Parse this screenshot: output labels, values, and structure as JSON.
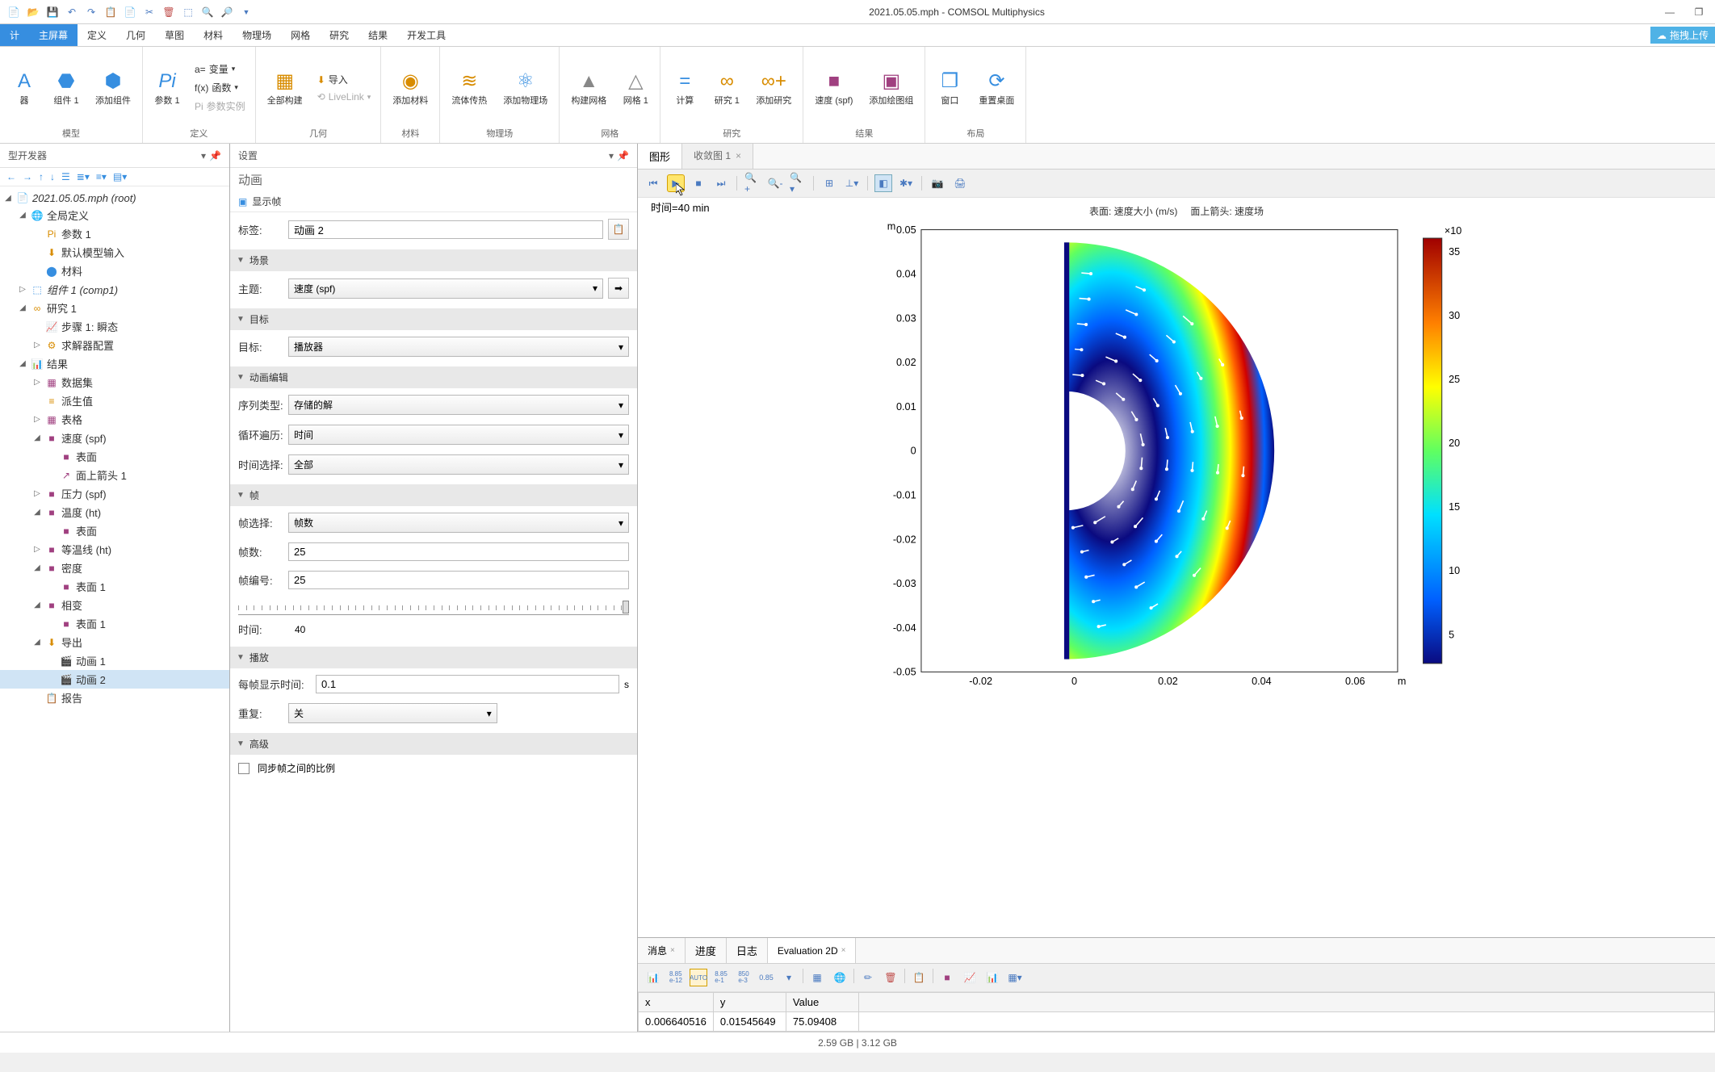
{
  "app_title": "2021.05.05.mph - COMSOL Multiphysics",
  "cloud_btn": "拖拽上传",
  "menu_tabs": [
    "计",
    "主屏幕",
    "定义",
    "几何",
    "草图",
    "材料",
    "物理场",
    "网格",
    "研究",
    "结果",
    "开发工具"
  ],
  "ribbon": {
    "model": {
      "label": "模型",
      "items": [
        "器",
        "组件 1",
        "添加组件"
      ]
    },
    "definition": {
      "label": "定义",
      "main": "参数 1",
      "sub": [
        "变量",
        "函数",
        "参数实例"
      ]
    },
    "geometry": {
      "label": "几何",
      "main": "全部构建",
      "sub": [
        "导入",
        "LiveLink"
      ]
    },
    "material": {
      "label": "材料",
      "main": "添加材料"
    },
    "physics": {
      "label": "物理场",
      "items": [
        "流体传热",
        "添加物理场"
      ]
    },
    "mesh": {
      "label": "网格",
      "items": [
        "构建网格",
        "网格 1"
      ]
    },
    "study": {
      "label": "研究",
      "items": [
        "计算",
        "研究 1",
        "添加研究"
      ]
    },
    "results": {
      "label": "结果",
      "items": [
        "速度 (spf)",
        "添加绘图组"
      ]
    },
    "layout": {
      "label": "布局",
      "items": [
        "窗口",
        "重置桌面"
      ]
    }
  },
  "tree_panel_title": "型开发器",
  "tree": [
    {
      "indent": 0,
      "exp": "◢",
      "icon": "📄",
      "label": "2021.05.05.mph (root)",
      "italic": true
    },
    {
      "indent": 1,
      "exp": "◢",
      "icon": "🌐",
      "label": "全局定义",
      "color": "#d88c00"
    },
    {
      "indent": 2,
      "exp": "",
      "icon": "Pi",
      "label": "参数 1",
      "iconcolor": "#d88c00"
    },
    {
      "indent": 2,
      "exp": "",
      "icon": "⬇",
      "label": "默认模型输入",
      "iconcolor": "#d88c00"
    },
    {
      "indent": 2,
      "exp": "",
      "icon": "⬤",
      "label": "材料",
      "iconcolor": "#368ee0"
    },
    {
      "indent": 1,
      "exp": "▷",
      "icon": "⬚",
      "label": "组件 1 (comp1)",
      "italic": true,
      "iconcolor": "#368ee0"
    },
    {
      "indent": 1,
      "exp": "◢",
      "icon": "∞",
      "label": "研究 1",
      "iconcolor": "#d88c00"
    },
    {
      "indent": 2,
      "exp": "",
      "icon": "📈",
      "label": "步骤 1: 瞬态",
      "iconcolor": "#368ee0"
    },
    {
      "indent": 2,
      "exp": "▷",
      "icon": "⚙",
      "label": "求解器配置",
      "iconcolor": "#d88c00"
    },
    {
      "indent": 1,
      "exp": "◢",
      "icon": "📊",
      "label": "结果",
      "iconcolor": "#a04080"
    },
    {
      "indent": 2,
      "exp": "▷",
      "icon": "▦",
      "label": "数据集",
      "iconcolor": "#a04080"
    },
    {
      "indent": 2,
      "exp": "",
      "icon": "≡",
      "label": "派生值",
      "iconcolor": "#d88c00"
    },
    {
      "indent": 2,
      "exp": "▷",
      "icon": "▦",
      "label": "表格",
      "iconcolor": "#a04080"
    },
    {
      "indent": 2,
      "exp": "◢",
      "icon": "■",
      "label": "速度 (spf)",
      "iconcolor": "#a04080"
    },
    {
      "indent": 3,
      "exp": "",
      "icon": "■",
      "label": "表面",
      "iconcolor": "#a04080"
    },
    {
      "indent": 3,
      "exp": "",
      "icon": "↗",
      "label": "面上箭头 1",
      "iconcolor": "#a04080"
    },
    {
      "indent": 2,
      "exp": "▷",
      "icon": "■",
      "label": "压力 (spf)",
      "iconcolor": "#a04080"
    },
    {
      "indent": 2,
      "exp": "◢",
      "icon": "■",
      "label": "温度 (ht)",
      "iconcolor": "#a04080"
    },
    {
      "indent": 3,
      "exp": "",
      "icon": "■",
      "label": "表面",
      "iconcolor": "#a04080"
    },
    {
      "indent": 2,
      "exp": "▷",
      "icon": "■",
      "label": "等温线 (ht)",
      "iconcolor": "#a04080"
    },
    {
      "indent": 2,
      "exp": "◢",
      "icon": "■",
      "label": "密度",
      "iconcolor": "#a04080"
    },
    {
      "indent": 3,
      "exp": "",
      "icon": "■",
      "label": "表面 1",
      "iconcolor": "#a04080"
    },
    {
      "indent": 2,
      "exp": "◢",
      "icon": "■",
      "label": "相变",
      "iconcolor": "#a04080"
    },
    {
      "indent": 3,
      "exp": "",
      "icon": "■",
      "label": "表面 1",
      "iconcolor": "#a04080"
    },
    {
      "indent": 2,
      "exp": "◢",
      "icon": "⬇",
      "label": "导出",
      "iconcolor": "#d88c00"
    },
    {
      "indent": 3,
      "exp": "",
      "icon": "🎬",
      "label": "动画 1",
      "iconcolor": "#a04080"
    },
    {
      "indent": 3,
      "exp": "",
      "icon": "🎬",
      "label": "动画 2",
      "selected": true,
      "iconcolor": "#a04080"
    },
    {
      "indent": 2,
      "exp": "",
      "icon": "📋",
      "label": "报告",
      "iconcolor": "#a04080"
    }
  ],
  "settings": {
    "title": "设置",
    "subtitle": "动画",
    "show_frame": "显示帧",
    "label_field": {
      "label": "标签:",
      "value": "动画 2"
    },
    "section_scene": "场景",
    "subject": {
      "label": "主题:",
      "value": "速度 (spf)"
    },
    "section_target": "目标",
    "target": {
      "label": "目标:",
      "value": "播放器"
    },
    "section_edit": "动画编辑",
    "seq_type": {
      "label": "序列类型:",
      "value": "存储的解"
    },
    "loop": {
      "label": "循环遍历:",
      "value": "时间"
    },
    "time_sel": {
      "label": "时间选择:",
      "value": "全部"
    },
    "section_frame": "帧",
    "frame_sel": {
      "label": "帧选择:",
      "value": "帧数"
    },
    "frames": {
      "label": "帧数:",
      "value": "25"
    },
    "frame_no": {
      "label": "帧编号:",
      "value": "25"
    },
    "time": {
      "label": "时间:",
      "value": "40"
    },
    "section_play": "播放",
    "per_frame": {
      "label": "每帧显示时间:",
      "value": "0.1",
      "unit": "s"
    },
    "repeat": {
      "label": "重复:",
      "value": "关"
    },
    "section_adv": "高级",
    "sync_scale": "同步帧之间的比例"
  },
  "graphics": {
    "tab1": "图形",
    "tab2": "收敛图 1",
    "time_label": "时间=40 min",
    "surf_title": "表面: 速度大小 (m/s)",
    "arrow_title": "面上箭头: 速度场",
    "y_unit": "m",
    "x_unit": "m",
    "cb_unit": "×10",
    "y_ticks": [
      "0.05",
      "0.04",
      "0.03",
      "0.02",
      "0.01",
      "0",
      "-0.01",
      "-0.02",
      "-0.03",
      "-0.04",
      "-0.05"
    ],
    "x_ticks": [
      "-0.02",
      "0",
      "0.02",
      "0.04",
      "0.06"
    ],
    "cb_ticks": [
      "35",
      "30",
      "25",
      "20",
      "15",
      "10",
      "5"
    ]
  },
  "bottom_tabs": [
    "消息",
    "进度",
    "日志",
    "Evaluation 2D"
  ],
  "eval_table": {
    "headers": [
      "x",
      "y",
      "Value"
    ],
    "row": [
      "0.006640516",
      "0.01545649",
      "75.09408"
    ]
  },
  "status": "2.59 GB | 3.12 GB",
  "chart_data": {
    "type": "surface-2d",
    "title": "表面: 速度大小 (m/s)  面上箭头: 速度场",
    "time": "40 min",
    "xlabel": "m",
    "ylabel": "m",
    "xlim": [
      -0.03,
      0.07
    ],
    "ylim": [
      -0.055,
      0.055
    ],
    "colorbar_range": [
      0,
      40
    ],
    "colorbar_scale": "×10",
    "description": "2D axisymmetric velocity magnitude plot (half-disk, radius ~0.05) with arrow surface showing velocity field; jet colormap; high-velocity band (red, ~35) forms an arc near outer radius of half-disk, low velocity (dark blue, ~0-5) at inner and along straight edge.",
    "yticks": [
      0.05,
      0.04,
      0.03,
      0.02,
      0.01,
      0,
      -0.01,
      -0.02,
      -0.03,
      -0.04,
      -0.05
    ],
    "xticks": [
      -0.02,
      0,
      0.02,
      0.04,
      0.06
    ],
    "cbticks": [
      35,
      30,
      25,
      20,
      15,
      10,
      5
    ]
  }
}
